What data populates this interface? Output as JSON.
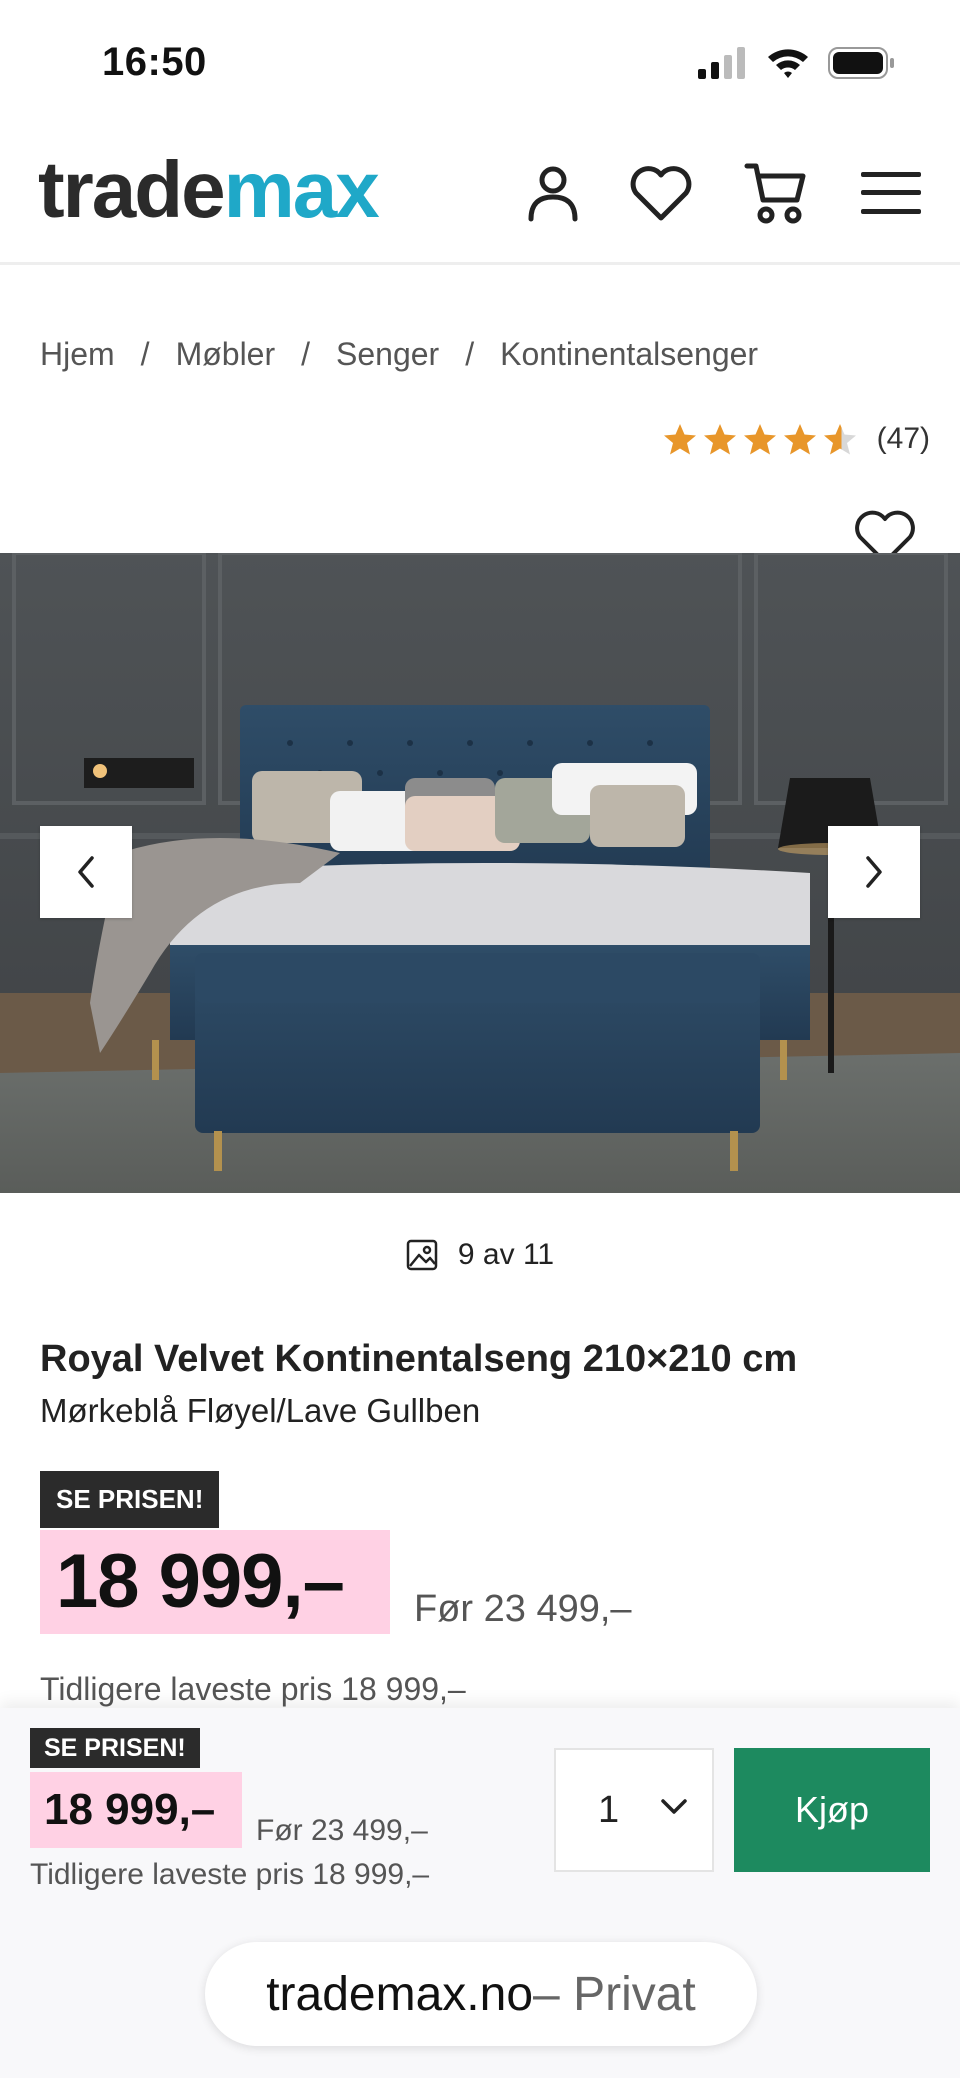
{
  "status_bar": {
    "time": "16:50"
  },
  "header": {
    "logo_part1": "trade",
    "logo_part2": "max",
    "icons": [
      "user-icon",
      "heart-icon",
      "cart-icon",
      "menu-icon"
    ]
  },
  "breadcrumb": {
    "items": [
      "Hjem",
      "Møbler",
      "Senger",
      "Kontinentalsenger"
    ],
    "separator": "/"
  },
  "rating": {
    "stars": 4.5,
    "count": "(47)"
  },
  "gallery": {
    "counter": "9 av 11"
  },
  "product": {
    "title": "Royal Velvet Kontinentalseng 210×210 cm",
    "subtitle": "Mørkeblå Fløyel/Lave Gullben",
    "badge": "SE PRISEN!",
    "price": "18 999,–",
    "old_price": "Før 23 499,–",
    "lowest_price": "Tidligere laveste pris 18 999,–"
  },
  "sticky_bar": {
    "badge": "SE PRISEN!",
    "price": "18 999,–",
    "old_price": "Før 23 499,–",
    "lowest_price": "Tidligere laveste pris 18 999,–",
    "quantity": "1",
    "buy_label": "Kjøp"
  },
  "browser": {
    "domain": "trademax.no",
    "mode": " – Privat"
  },
  "colors": {
    "brand_teal": "#1fa8c8",
    "buy_green": "#1d8a5f",
    "price_pink": "#ffd1e4",
    "star_orange": "#e8962a"
  }
}
